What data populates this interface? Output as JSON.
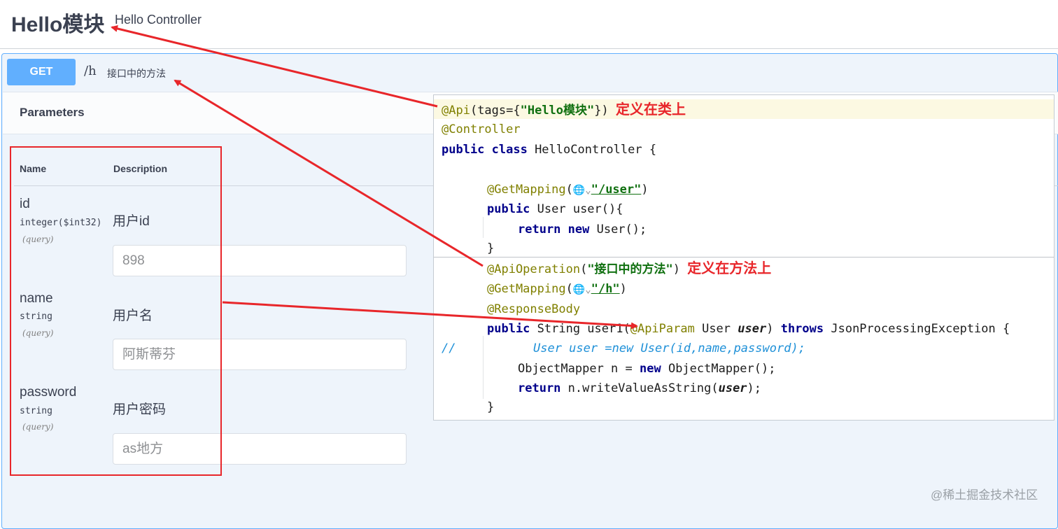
{
  "header": {
    "tag_name": "Hello模块",
    "tag_description": "Hello Controller"
  },
  "operation": {
    "method": "GET",
    "path": "/h",
    "summary": "接口中的方法"
  },
  "parameters": {
    "title": "Parameters",
    "columns": {
      "name": "Name",
      "description": "Description"
    },
    "items": [
      {
        "name": "id",
        "type": "integer($int32)",
        "in": "(query)",
        "description": "用户id",
        "placeholder": "898"
      },
      {
        "name": "name",
        "type": "string",
        "in": "(query)",
        "description": "用户名",
        "placeholder": "阿斯蒂芬"
      },
      {
        "name": "password",
        "type": "string",
        "in": "(query)",
        "description": "用户密码",
        "placeholder": "as地方"
      }
    ]
  },
  "code": {
    "l1_ann": "@Api",
    "l1_mid": "(tags={",
    "l1_str": "\"Hello模块\"",
    "l1_end": "})",
    "l1_note": "定义在类上",
    "l2": "@Controller",
    "l3_kw": "public class",
    "l3_rest": " HelloController {",
    "l4_ann": "@GetMapping",
    "l4_open": "(",
    "l4_icon": "🌐⌄",
    "l4_str": "\"/user\"",
    "l4_close": ")",
    "l5_kw": "public",
    "l5_rest": " User user(){",
    "l6_kw": "return new",
    "l6_rest": " User();",
    "l7": "}",
    "l8_ann": "@ApiOperation",
    "l8_open": "(",
    "l8_str": "\"接口中的方法\"",
    "l8_close": ")",
    "l8_note": "定义在方法上",
    "l9_ann": "@GetMapping",
    "l9_open": "(",
    "l9_icon": "🌐⌄",
    "l9_str": "\"/h\"",
    "l9_close": ")",
    "l10": "@ResponseBody",
    "l11_kw": "public",
    "l11_a": " String user1(",
    "l11_ann": "@ApiParam",
    "l11_b": " User ",
    "l11_var": "user",
    "l11_c": ") ",
    "l11_kw2": "throws",
    "l11_d": " JsonProcessingException {",
    "l12_slash": "//",
    "l12_rest": "User user =new User(id,name,password);",
    "l13_a": "ObjectMapper n = ",
    "l13_kw": "new",
    "l13_b": " ObjectMapper();",
    "l14_kw": "return",
    "l14_a": " n.writeValueAsString(",
    "l14_var": "user",
    "l14_b": ");",
    "l15": "}"
  },
  "watermark": "@稀土掘金技术社区",
  "colors": {
    "get_method": "#61affe",
    "annotation_arrow": "#e8262a"
  }
}
